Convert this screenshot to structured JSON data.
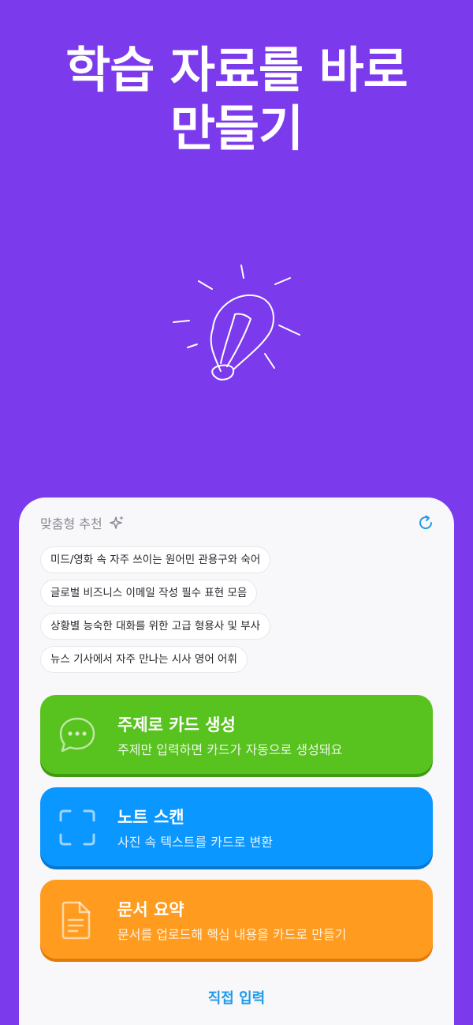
{
  "hero": {
    "title_line1": "학습 자료를 바로",
    "title_line2": "만들기"
  },
  "recommend": {
    "label": "맞춤형 추천",
    "icons": {
      "sparkle": "sparkle-icon",
      "refresh": "refresh-icon"
    },
    "chips": [
      "미드/영화 속 자주 쓰이는 원어민 관용구와 숙어",
      "글로벌 비즈니스 이메일 작성 필수 표현 모음",
      "상황별 능숙한 대화를 위한 고급 형용사 및 부사",
      "뉴스 기사에서 자주 만나는 시사 영어 어휘"
    ]
  },
  "actions": [
    {
      "title": "주제로 카드 생성",
      "desc": "주제만 입력하면 카드가 자동으로 생성돼요",
      "icon": "chat-bubble-icon",
      "color": "#58c21f"
    },
    {
      "title": "노트 스캔",
      "desc": "사진 속 텍스트를 카드로 변환",
      "icon": "scan-frame-icon",
      "color": "#0a97ff"
    },
    {
      "title": "문서 요약",
      "desc": "문서를 업로드해 핵심 내용을 카드로 만들기",
      "icon": "document-icon",
      "color": "#ff9b1f"
    }
  ],
  "footer": {
    "direct_input": "직접 입력"
  },
  "colors": {
    "background": "#7c3aed",
    "sheet": "#f8f8fb",
    "link": "#1f9be8"
  }
}
